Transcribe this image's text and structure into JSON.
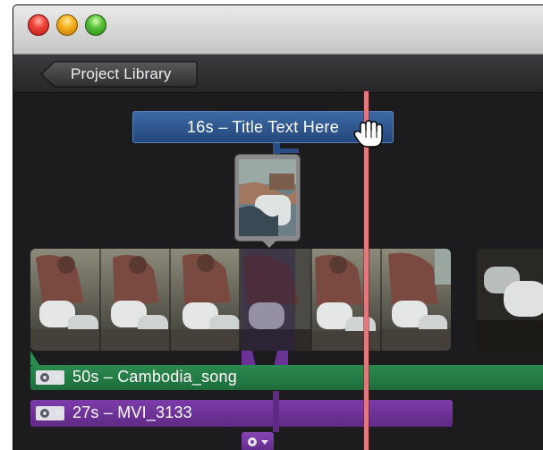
{
  "window": {
    "controls": [
      "close",
      "minimize",
      "zoom"
    ]
  },
  "toolbar": {
    "back_label": "Project Library"
  },
  "timeline": {
    "title_clip": "16s – Title Text Here",
    "music_clip": "50s – Cambodia_song",
    "video_clip": "27s – MVI_3133"
  },
  "colors": {
    "title_bar": "#2e5690",
    "music_bar": "#23784a",
    "video_bar": "#6b3396",
    "playhead": "#e8757a"
  },
  "icons": [
    "close-button",
    "minimize-button",
    "zoom-button",
    "back-arrow-icon",
    "gear-icon",
    "hand-cursor-icon"
  ]
}
